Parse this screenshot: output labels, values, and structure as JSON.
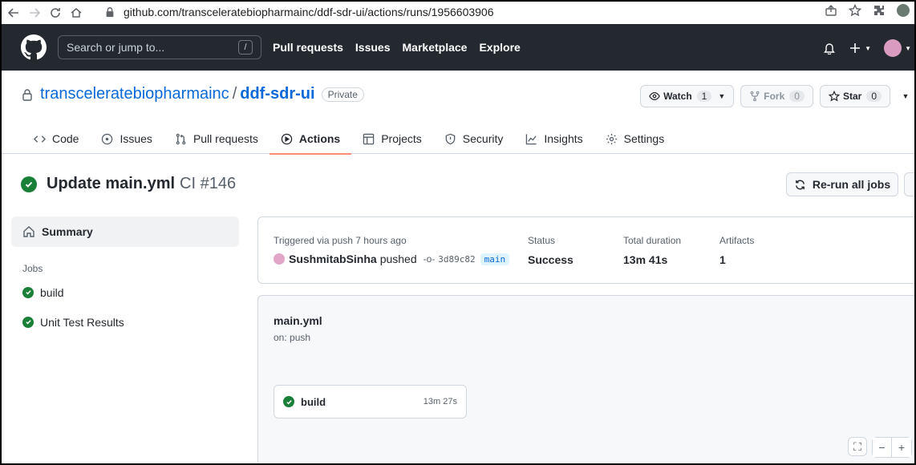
{
  "browser": {
    "url": "github.com/transceleratebiopharmainc/ddf-sdr-ui/actions/runs/1956603906"
  },
  "header": {
    "search_placeholder": "Search or jump to...",
    "search_key": "/",
    "nav": [
      "Pull requests",
      "Issues",
      "Marketplace",
      "Explore"
    ]
  },
  "repo": {
    "owner": "transceleratebiopharmainc",
    "separator": "/",
    "name": "ddf-sdr-ui",
    "visibility": "Private",
    "watch_label": "Watch",
    "watch_count": "1",
    "fork_label": "Fork",
    "fork_count": "0",
    "star_label": "Star",
    "star_count": "0",
    "tabs": [
      "Code",
      "Issues",
      "Pull requests",
      "Actions",
      "Projects",
      "Security",
      "Insights",
      "Settings"
    ]
  },
  "run": {
    "title": "Update main.yml",
    "subtitle": "CI #146",
    "rerun_label": "Re-run all jobs"
  },
  "sidebar": {
    "summary_label": "Summary",
    "jobs_label": "Jobs",
    "jobs": [
      "build",
      "Unit Test Results"
    ]
  },
  "summary": {
    "trigger_label": "Triggered via push 7 hours ago",
    "user": "SushmitabSinha",
    "verb": "pushed",
    "sha": "3d89c82",
    "branch": "main",
    "status_label": "Status",
    "status_value": "Success",
    "duration_label": "Total duration",
    "duration_value": "13m 41s",
    "artifacts_label": "Artifacts",
    "artifacts_value": "1"
  },
  "workflow": {
    "name": "main.yml",
    "trigger": "on: push",
    "job_name": "build",
    "job_time": "13m 27s"
  },
  "colors": {
    "header_bg": "#24292f",
    "success": "#1a7f37",
    "link": "#0969da",
    "active_tab_underline": "#fd8c73"
  }
}
